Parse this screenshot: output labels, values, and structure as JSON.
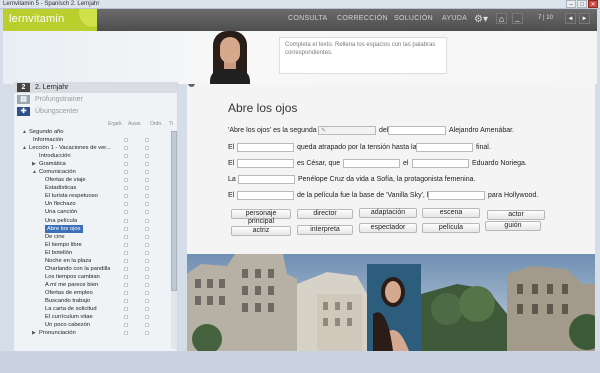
{
  "window": {
    "title": "Lernvitamin 5 - Spanisch 2. Lernjahr",
    "controls": {
      "minimize": "–",
      "maximize": "□",
      "close": "✕"
    }
  },
  "app": {
    "logo": "lernvitamin",
    "nav": [
      "CONSULTA",
      "CORRECCIÓN",
      "SOLUCIÓN",
      "AYUDA"
    ],
    "gear_icon": "gear-icon",
    "home_icon": "home-icon",
    "minimize_label": "_",
    "page_indicator": "7 | 10",
    "prev_label": "◄",
    "next_label": "►"
  },
  "instruction": "Completa el texto. Rellena los espacios con las palabras correspondientes.",
  "sidebar": {
    "levels": [
      {
        "icon": "2",
        "label": "2. Lernjahr"
      },
      {
        "icon": "",
        "label": "Prüfungstrainer"
      },
      {
        "icon": "",
        "label": "Übungscenter"
      }
    ],
    "columns": [
      "Ergeb.",
      "Ausw.",
      "Ordn.",
      "Ti"
    ],
    "tree": [
      {
        "label": "Segundo año",
        "indent": 1,
        "arrow": "▲",
        "cb": false
      },
      {
        "label": "Información",
        "indent": 2,
        "arrow": "",
        "cb": true
      },
      {
        "label": "Lección 1 - Vacaciones de ver...",
        "indent": 1,
        "arrow": "▲",
        "cb": true
      },
      {
        "label": "Introducción",
        "indent": 3,
        "arrow": "",
        "cb": true
      },
      {
        "label": "Gramática",
        "indent": 3,
        "arrow": "▶",
        "cb": true
      },
      {
        "label": "Comunicación",
        "indent": 3,
        "arrow": "▲",
        "cb": true
      },
      {
        "label": "Ofertas de viaje",
        "indent": 4,
        "arrow": "",
        "cb": true
      },
      {
        "label": "Estadísticas",
        "indent": 4,
        "arrow": "",
        "cb": true
      },
      {
        "label": "El turista respetuoso",
        "indent": 4,
        "arrow": "",
        "cb": true
      },
      {
        "label": "Un flechazo",
        "indent": 4,
        "arrow": "",
        "cb": true
      },
      {
        "label": "Una canción",
        "indent": 4,
        "arrow": "",
        "cb": true
      },
      {
        "label": "Una película",
        "indent": 4,
        "arrow": "",
        "cb": true
      },
      {
        "label": "Abre los ojos",
        "indent": 4,
        "arrow": "",
        "cb": true,
        "selected": true
      },
      {
        "label": "De cine",
        "indent": 4,
        "arrow": "",
        "cb": true
      },
      {
        "label": "El tiempo libre",
        "indent": 4,
        "arrow": "",
        "cb": true
      },
      {
        "label": "El botellón",
        "indent": 4,
        "arrow": "",
        "cb": true
      },
      {
        "label": "Noche en la plaza",
        "indent": 4,
        "arrow": "",
        "cb": true
      },
      {
        "label": "Charlando con la pandilla",
        "indent": 4,
        "arrow": "",
        "cb": true
      },
      {
        "label": "Los tiempos cambian",
        "indent": 4,
        "arrow": "",
        "cb": true
      },
      {
        "label": "A mí me parece bien",
        "indent": 4,
        "arrow": "",
        "cb": true
      },
      {
        "label": "Ofertas de empleo",
        "indent": 4,
        "arrow": "",
        "cb": true
      },
      {
        "label": "Buscando trabajo",
        "indent": 4,
        "arrow": "",
        "cb": true
      },
      {
        "label": "La carta de solicitud",
        "indent": 4,
        "arrow": "",
        "cb": true
      },
      {
        "label": "El currículum vitae",
        "indent": 4,
        "arrow": "",
        "cb": true
      },
      {
        "label": "Un poco cabezón",
        "indent": 4,
        "arrow": "",
        "cb": true
      },
      {
        "label": "Pronunciación",
        "indent": 3,
        "arrow": "▶",
        "cb": true
      }
    ]
  },
  "exercise": {
    "title": "Abre los ojos",
    "s1": {
      "a": "'Abre los ojos' es la segunda",
      "b": "del",
      "c": "Alejandro Amenábar."
    },
    "s2": {
      "a": "El",
      "b": "queda atrapado por la tensión hasta la",
      "c": "final."
    },
    "s3": {
      "a": "El",
      "b": "es César, que",
      "c": "el",
      "d": "Eduardo Noriega."
    },
    "s4": {
      "a": "La",
      "b": "Penélope Cruz da vida a Sofía, la protagonista femenina."
    },
    "s5": {
      "a": "El",
      "b": "de la película fue la base de 'Vanilla Sky', la",
      "c": "para Hollywood."
    },
    "words": [
      "personaje principal",
      "director",
      "adaptación",
      "escena",
      "actor",
      "actriz",
      "interpreta",
      "espectador",
      "película",
      "guión"
    ]
  },
  "colors": {
    "brand_green": "#b8cf2e",
    "nav_dark": "#555555",
    "selection_blue": "#3b6fb7"
  }
}
